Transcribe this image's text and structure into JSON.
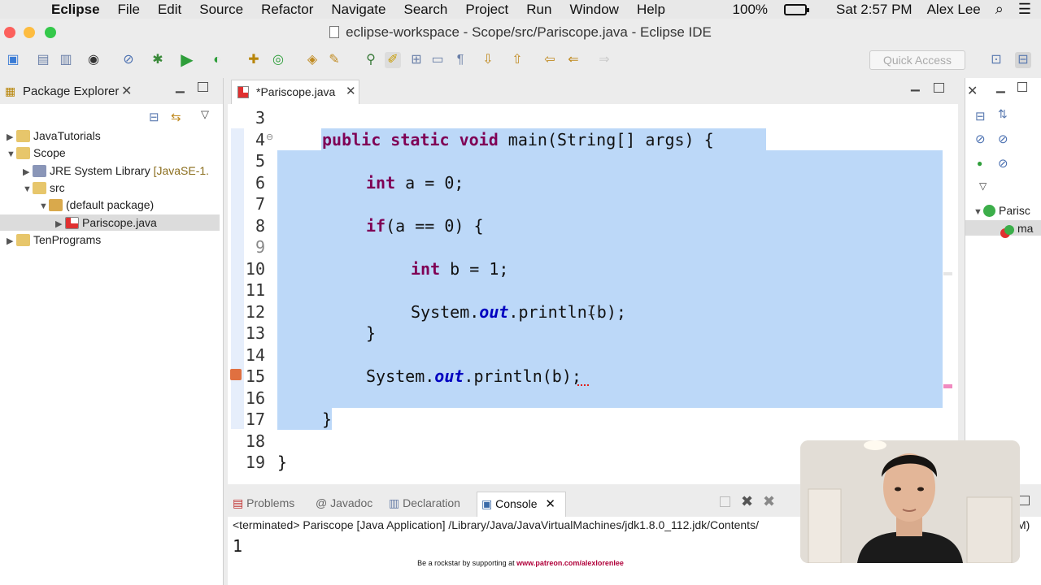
{
  "menubar": {
    "app": "Eclipse",
    "items": [
      "File",
      "Edit",
      "Source",
      "Refactor",
      "Navigate",
      "Search",
      "Project",
      "Run",
      "Window",
      "Help"
    ],
    "battery": "100%",
    "clock": "Sat 2:57 PM",
    "user": "Alex Lee"
  },
  "window": {
    "title": "eclipse-workspace - Scope/src/Pariscope.java - Eclipse IDE"
  },
  "toolbar": {
    "quick_access_placeholder": "Quick Access"
  },
  "package_explorer": {
    "title": "Package Explorer",
    "tree": [
      {
        "label": "JavaTutorials"
      },
      {
        "label": "Scope"
      },
      {
        "label": "JRE System Library",
        "suffix": "[JavaSE-1."
      },
      {
        "label": "src"
      },
      {
        "label": "(default package)"
      },
      {
        "label": "Pariscope.java"
      },
      {
        "label": "TenPrograms"
      }
    ]
  },
  "editor": {
    "tab": "*Pariscope.java",
    "line_numbers": [
      "3",
      "4",
      "5",
      "6",
      "7",
      "8",
      "9",
      "10",
      "11",
      "12",
      "13",
      "14",
      "15",
      "16",
      "17",
      "18",
      "19"
    ],
    "lines": {
      "l4": {
        "kw": "public static void",
        "rest": " main(String[] args) {"
      },
      "l6": {
        "kw": "int",
        "rest": " a = 0;"
      },
      "l8": {
        "kw": "if",
        "rest": "(a == 0) {"
      },
      "l10": {
        "kw": "int",
        "rest": " b = 1;"
      },
      "l12": {
        "pre": "System.",
        "field": "out",
        "post": ".println(b);"
      },
      "l13": "}",
      "l15": {
        "pre": "System.",
        "field": "out",
        "post": ".println(b);"
      },
      "l17": "}",
      "l19": "}"
    }
  },
  "console": {
    "tabs": [
      "Problems",
      "Javadoc",
      "Declaration",
      "Console"
    ],
    "status": "<terminated> Pariscope [Java Application] /Library/Java/JavaVirtualMachines/jdk1.8.0_112.jdk/Contents/",
    "status_tail": "M)",
    "output": "1"
  },
  "outline": {
    "class_label": "Parisc",
    "member_label": "ma"
  },
  "footer": {
    "text": "Be a rockstar by supporting at ",
    "link": "www.patreon.com/alexlorenlee"
  },
  "colors": {
    "keyword": "#7f0055",
    "field": "#0000c0",
    "selection": "#bcd8f8"
  }
}
